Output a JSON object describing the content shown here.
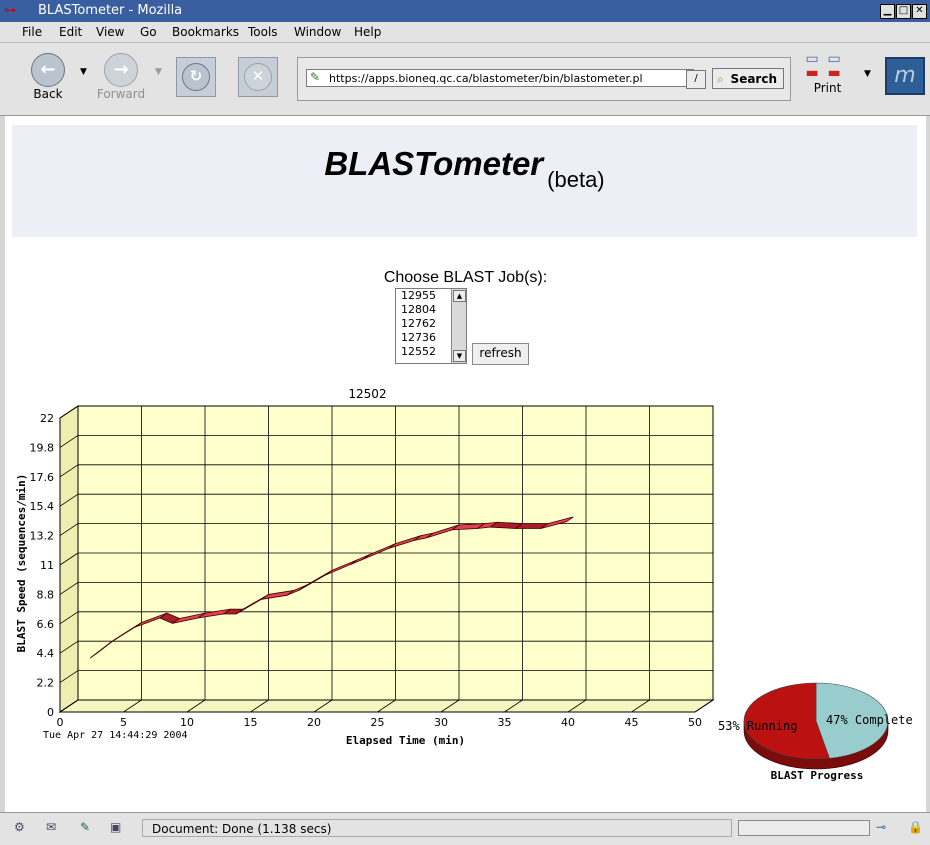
{
  "window": {
    "title": "BLASTometer - Mozilla"
  },
  "menu": [
    "File",
    "Edit",
    "View",
    "Go",
    "Bookmarks",
    "Tools",
    "Window",
    "Help"
  ],
  "toolbar": {
    "back": "Back",
    "forward": "Forward",
    "url": "https://apps.bioneq.qc.ca/blastometer/bin/blastometer.pl",
    "search": "Search",
    "print": "Print"
  },
  "page": {
    "title": "BLASTometer",
    "beta": "(beta)",
    "choose_label": "Choose BLAST Job(s):",
    "jobs": [
      "12955",
      "12804",
      "12762",
      "12736",
      "12552"
    ],
    "refresh": "refresh"
  },
  "chart_data": [
    {
      "type": "area",
      "title": "12502",
      "xlabel": "Elapsed Time (min)",
      "ylabel": "BLAST Speed (sequences/min)",
      "timestamp": "Tue Apr 27 14:44:29 2004",
      "xlim": [
        0,
        50
      ],
      "ylim": [
        0,
        22
      ],
      "xticks": [
        "0",
        "5",
        "10",
        "15",
        "20",
        "25",
        "30",
        "35",
        "40",
        "45",
        "50"
      ],
      "yticks": [
        "0",
        "2.2",
        "4.4",
        "6.6",
        "8.8",
        "11",
        "13.2",
        "15.4",
        "17.6",
        "19.8",
        "22"
      ],
      "grid": true,
      "color": "#e04050",
      "series": [
        {
          "x": [
            1.5,
            3,
            5,
            7,
            8,
            10,
            12,
            13,
            15,
            17,
            18,
            20,
            22,
            23,
            25,
            27,
            28,
            30,
            32,
            33,
            35,
            37,
            39
          ],
          "values": [
            3.5,
            4.6,
            5.8,
            6.5,
            6.1,
            6.5,
            6.8,
            6.8,
            7.9,
            8.2,
            8.6,
            9.7,
            10.5,
            10.9,
            11.7,
            12.3,
            12.5,
            13.1,
            13.2,
            13.3,
            13.2,
            13.2,
            13.7
          ]
        }
      ]
    },
    {
      "type": "pie",
      "title": "BLAST Progress",
      "categories": [
        "Running",
        "Complete"
      ],
      "values": [
        53,
        47
      ],
      "labels": [
        "53% Running",
        "47% Complete"
      ],
      "colors": [
        "#bb1111",
        "#99cccc"
      ]
    }
  ],
  "status": {
    "text": "Document: Done (1.138 secs)"
  }
}
